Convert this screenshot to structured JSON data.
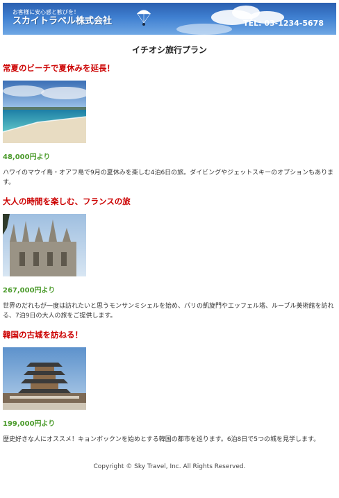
{
  "header": {
    "tagline": "お客様に安心感と歓びを！",
    "company": "スカイトラベル株式会社",
    "tel": "TEL: 03-1234-5678",
    "icon": "parachute-icon"
  },
  "main": {
    "title": "イチオシ旅行プラン"
  },
  "plans": [
    {
      "title": "常夏のビーチで夏休みを延長！",
      "photo": "beach-photo",
      "price": "48,000円より",
      "description": "ハワイのマウイ島・オアフ島で9月の夏休みを楽しむ4泊6日の旅。ダイビングやジェットスキーのオプションもあります。"
    },
    {
      "title": "大人の時間を楽しむ、フランスの旅",
      "photo": "cathedral-photo",
      "price": "267,000円より",
      "description": "世界のだれもが一度は訪れたいと思うモンサンミシェルを始め、パリの凱旋門やエッフェル塔、ルーブル美術館を訪れる、7泊9日の大人の旅をご提供します。"
    },
    {
      "title": "韓国の古城を訪ねる！",
      "photo": "palace-photo",
      "price": "199,000円より",
      "description": "歴史好きな人にオススメ！キョンボックンを始めとする韓国の都市を巡ります。6泊8日で5つの城を見学します。"
    }
  ],
  "footer": {
    "copyright": "Copyright © Sky Travel, Inc. All Rights Reserved."
  },
  "colors": {
    "plan_title": "#cc0000",
    "price": "#4a9a2a",
    "header_blue": "#2a5fb0"
  }
}
